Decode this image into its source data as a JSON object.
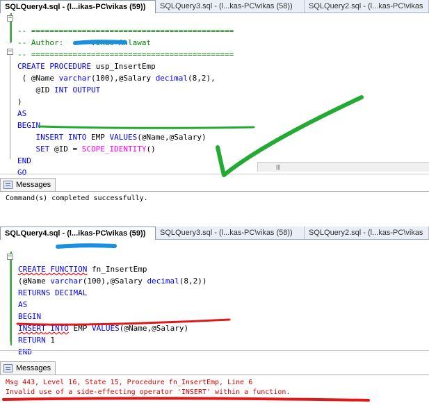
{
  "top_panel": {
    "tabs": [
      {
        "label": "SQLQuery4.sql - (l...ikas-PC\\vikas (59))",
        "active": true
      },
      {
        "label": "SQLQuery3.sql - (l...kas-PC\\vikas (58))",
        "active": false
      },
      {
        "label": "SQLQuery2.sql - (l...kas-PC\\vikas",
        "active": false
      }
    ],
    "code": {
      "l1": "-- ============================================",
      "l2_a": "-- Author:      ",
      "l2_b": "Vikas Ahlawat",
      "l3": "-- ============================================",
      "l4_kw1": "CREATE",
      "l4_kw2": "PROCEDURE",
      "l4_name": "usp_InsertEmp",
      "l5_a": "( @Name ",
      "l5_type1": "varchar",
      "l5_b": "(100),@Salary ",
      "l5_type2": "decimal",
      "l5_c": "(8,2),",
      "l6_a": "  @ID ",
      "l6_kw1": "INT",
      "l6_kw2": "OUTPUT",
      "l7": ")",
      "l8": "AS",
      "l9": "BEGIN",
      "l10_kw1": "INSERT",
      "l10_kw2": "INTO",
      "l10_tbl": "EMP",
      "l10_kw3": "VALUES",
      "l10_args": "(@Name,@Salary)",
      "l11_kw": "SET",
      "l11_a": "@ID = ",
      "l11_fn": "SCOPE_IDENTITY",
      "l11_b": "()",
      "l12": "END",
      "l13": "GO"
    },
    "messages_tab": "Messages",
    "message": "Command(s) completed successfully."
  },
  "bottom_panel": {
    "tabs": [
      {
        "label": "SQLQuery4.sql - (l...ikas-PC\\vikas (59))",
        "active": true
      },
      {
        "label": "SQLQuery3.sql - (l...kas-PC\\vikas (58))",
        "active": false
      },
      {
        "label": "SQLQuery2.sql - (l...kas-PC\\vikas",
        "active": false
      }
    ],
    "code": {
      "l1_kw1": "CREATE",
      "l1_kw2": "FUNCTION",
      "l1_name": "fn_InsertEmp",
      "l2_a": "(@Name ",
      "l2_type1": "varchar",
      "l2_b": "(100),@Salary ",
      "l2_type2": "decimal",
      "l2_c": "(8,2))",
      "l3_kw1": "RETURNS",
      "l3_kw2": "DECIMAL",
      "l4": "AS",
      "l5": "BEGIN",
      "l6_kw1": "INSERT",
      "l6_kw2": "INTO",
      "l6_tbl": "EMP",
      "l6_kw3": "VALUES",
      "l6_args": "(@Name,@Salary)",
      "l7_kw": "RETURN",
      "l7_val": "1",
      "l8": "END"
    },
    "messages_tab": "Messages",
    "error_line1": "Msg 443, Level 16, State 15, Procedure fn_InsertEmp, Line 6",
    "error_line2": "Invalid use of a side-effecting operator 'INSERT' within a function."
  },
  "colors": {
    "keyword": "#0000ff",
    "function": "#ff00ff",
    "comment": "#008000",
    "error": "#d40000",
    "annotation_green": "#22aa33",
    "annotation_red": "#e01818",
    "annotation_blue": "#1a8fe0"
  }
}
